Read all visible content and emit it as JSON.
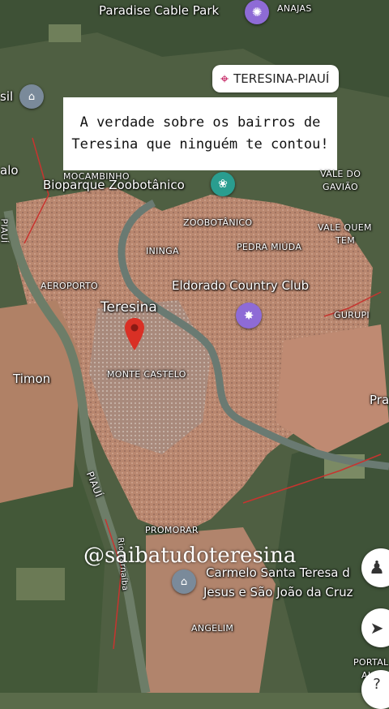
{
  "caption": "A verdade sobre os bairros de Teresina que ninguém te contou!",
  "location_chip": {
    "label": "TERESINA-PIAUÍ",
    "icon": "location-pin-icon"
  },
  "handle": "@saibatudoteresina",
  "places": {
    "paradise": "Paradise Cable Park",
    "anajas": "ANAJAS",
    "sil": "sil",
    "alo": "alo",
    "mocambinho": "MOCAMBINHO",
    "bioparque": "Bioparque Zoobotânico",
    "vale_gaviao_1": "VALE DO",
    "vale_gaviao_2": "GAVIÃO",
    "zoobotanico": "ZOOBOTÂNICO",
    "vale_quem_1": "VALE QUEM",
    "vale_quem_2": "TEM",
    "pi_vertical": "PIAUÍ",
    "ininga": "ININGA",
    "pedra_miuda": "PEDRA MIÚDA",
    "aeroporto": "AEROPORTO",
    "eldorado": "Eldorado Country Club",
    "teresina": "Teresina",
    "gurupi": "GURUPI",
    "timon": "Timon",
    "monte_castelo": "MONTE CASTELO",
    "pra": "Pra",
    "piaui_river": "PIAUÍ",
    "promorar": "PROMORAR",
    "rio_parnaiba": "Rio Parnaíba",
    "carmelo_1": "Carmelo Santa Teresa d",
    "carmelo_2": "Jesus e São João da Cruz",
    "angelim": "ANGELIM",
    "portal_1": "PORTAL",
    "portal_2": "ALE"
  },
  "colors": {
    "pin_red": "#d93025",
    "pin_purple": "#8e6bd6",
    "pin_green": "#2a9d8f",
    "pin_gray": "#7a8a9a"
  }
}
